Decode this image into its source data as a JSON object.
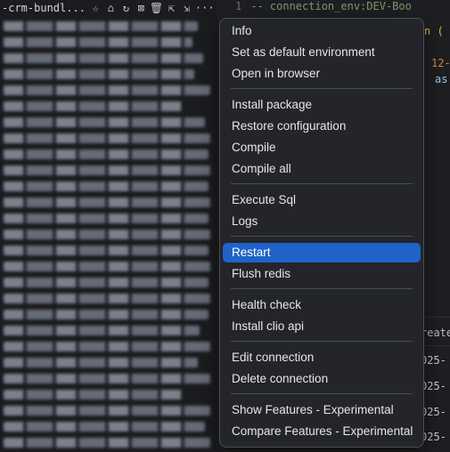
{
  "sidebar": {
    "header_title": "-crm-bundl...",
    "icons": [
      "star-icon",
      "home-icon",
      "refresh-icon",
      "close-box-icon",
      "trash-icon",
      "open-external-icon",
      "share-icon",
      "more-icon"
    ],
    "icon_glyphs": [
      "☆",
      "⌂",
      "↻",
      "⊠",
      "🗑",
      "⇱",
      "⇲",
      "···"
    ]
  },
  "editor": {
    "line_number": "1",
    "line_text": "-- connection_env:DEV-Boo",
    "frag_code_1": "n (",
    "frag_code_2": "12-",
    "frag_code_3": "as",
    "table_header": "reate",
    "table_cells": [
      "025-",
      "025-",
      "025-",
      "025-"
    ]
  },
  "menu": {
    "items": [
      "Info",
      "Set as default environment",
      "Open in browser",
      "Install package",
      "Restore configuration",
      "Compile",
      "Compile all",
      "Execute Sql",
      "Logs",
      "Restart",
      "Flush redis",
      "Health check",
      "Install clio api",
      "Edit connection",
      "Delete connection",
      "Show Features - Experimental",
      "Compare Features - Experimental"
    ],
    "active_item": "Restart",
    "accent_color": "#1f63c8"
  }
}
